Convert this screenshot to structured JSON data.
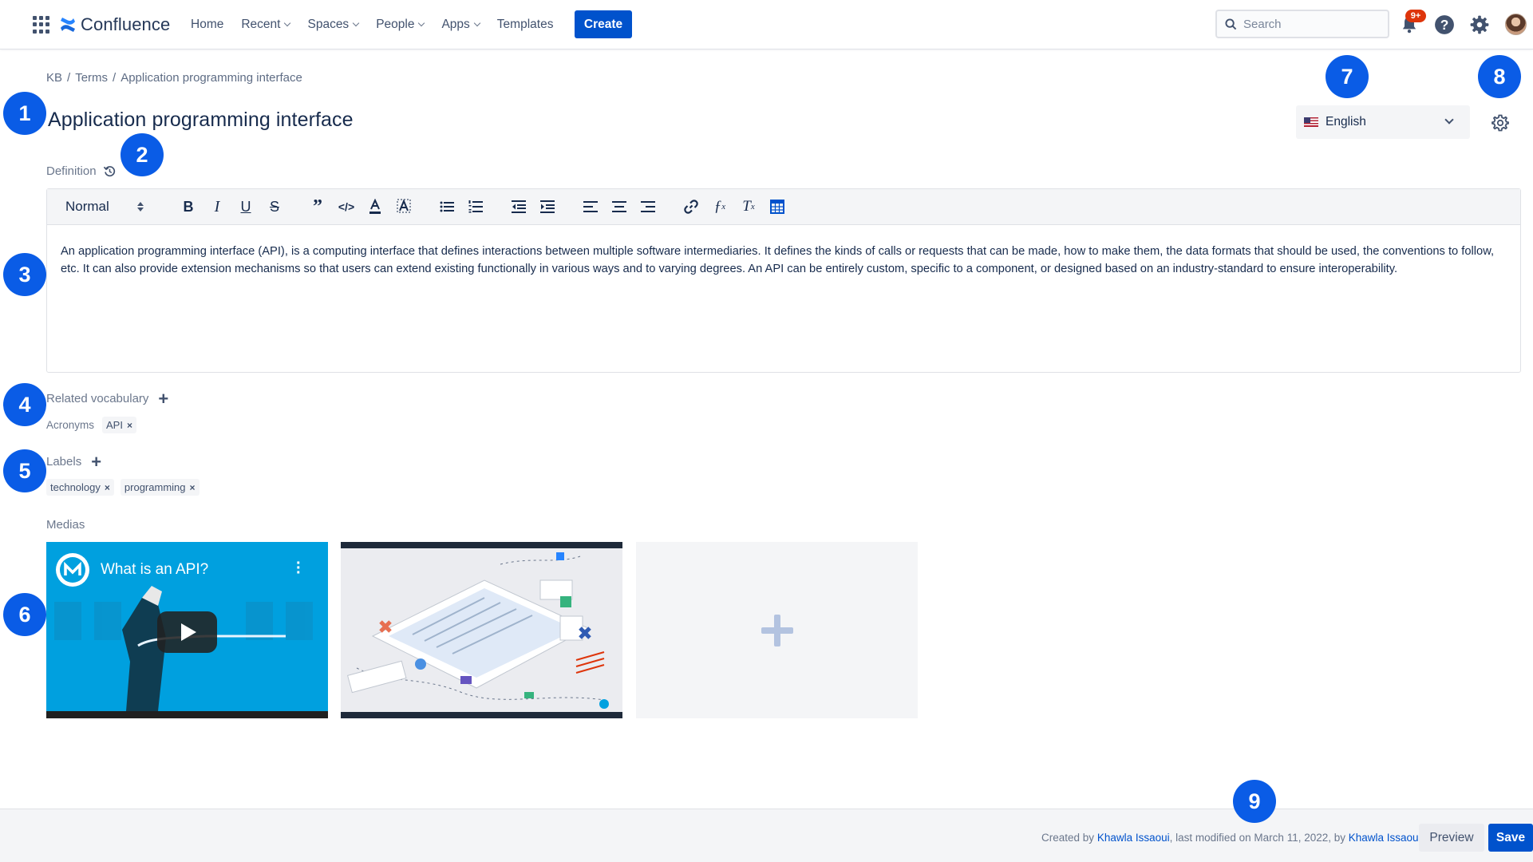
{
  "nav": {
    "app_name": "Confluence",
    "links": [
      {
        "label": "Home",
        "dropdown": false
      },
      {
        "label": "Recent",
        "dropdown": true
      },
      {
        "label": "Spaces",
        "dropdown": true
      },
      {
        "label": "People",
        "dropdown": true
      },
      {
        "label": "Apps",
        "dropdown": true
      },
      {
        "label": "Templates",
        "dropdown": false
      }
    ],
    "create_label": "Create",
    "search_placeholder": "Search",
    "notification_badge": "9+",
    "icons": [
      "app-switcher-icon",
      "confluence-logo-icon",
      "search-icon",
      "bell-icon",
      "help-icon",
      "gear-icon",
      "avatar"
    ]
  },
  "breadcrumb": [
    "KB",
    "Terms",
    "Application programming interface"
  ],
  "breadcrumb_separator": "/",
  "page": {
    "title": "Application programming interface",
    "language": "English"
  },
  "definition": {
    "label": "Definition",
    "style_value": "Normal",
    "toolbar_icons": [
      "bold-icon",
      "italic-icon",
      "underline-icon",
      "strike-icon",
      "quote-icon",
      "code-icon",
      "font-color-icon",
      "background-color-icon",
      "bullet-list-icon",
      "ordered-list-icon",
      "outdent-icon",
      "indent-icon",
      "align-left-icon",
      "align-center-icon",
      "align-right-icon",
      "link-icon",
      "formula-icon",
      "clear-format-icon",
      "table-icon"
    ],
    "text": "An application programming interface (API), is a computing interface that defines interactions between multiple software intermediaries. It defines the kinds of calls or requests that can be made, how to make them, the data formats that should be used, the conventions to follow, etc. It can also provide extension mechanisms so that users can extend existing functionally in various ways and to varying degrees. An API can be entirely custom, specific to a component, or designed based on an industry-standard to ensure interoperability."
  },
  "related_vocabulary": {
    "label": "Related vocabulary",
    "group_label": "Acronyms",
    "tags": [
      "API"
    ]
  },
  "labels": {
    "label": "Labels",
    "tags": [
      "technology",
      "programming"
    ]
  },
  "medias": {
    "label": "Medias",
    "video_title": "What is an API?"
  },
  "footer": {
    "created_prefix": "Created by",
    "created_by": "Khawla Issaoui",
    "modified_text": ", last modified on March 11, 2022, by",
    "modified_by": "Khawla Issaoui",
    "preview_label": "Preview",
    "save_label": "Save"
  },
  "markers": [
    "1",
    "2",
    "3",
    "4",
    "5",
    "6",
    "7",
    "8",
    "9"
  ],
  "colors": {
    "primary": "#0052cc",
    "marker": "#0a5ce6",
    "badge": "#de350b",
    "text": "#172b4d",
    "subtle": "#6b778c"
  }
}
